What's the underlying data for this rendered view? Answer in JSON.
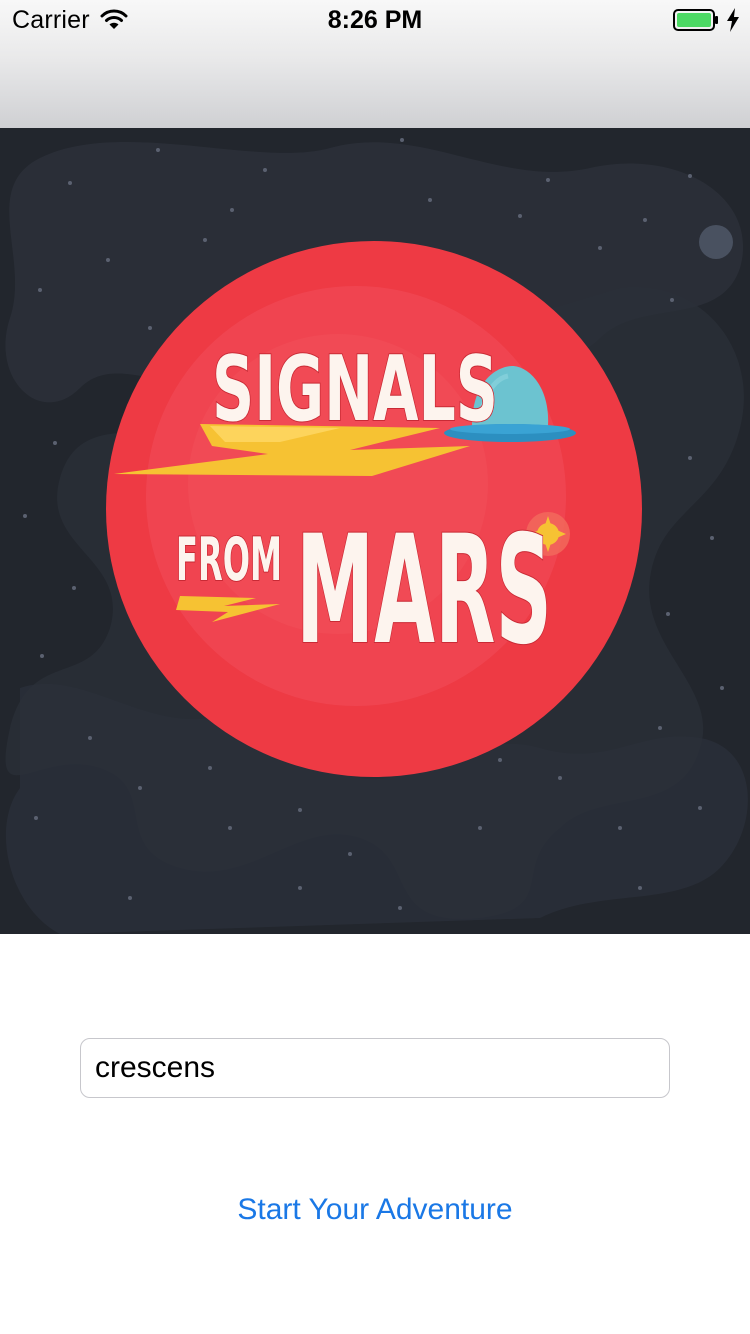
{
  "status_bar": {
    "carrier": "Carrier",
    "time": "8:26 PM",
    "icons": [
      "wifi-icon",
      "battery-icon",
      "charging-bolt-icon"
    ],
    "battery_color": "#4cd964"
  },
  "hero": {
    "logo_words": [
      "SIGNALS",
      "FROM",
      "MARS"
    ],
    "colors": {
      "space": "#22262d",
      "planet": "#ee3a44",
      "bolt": "#f6c233",
      "ufo_dome": "#6cc3d0",
      "ufo_disc": "#2c8fc0"
    }
  },
  "form": {
    "name_value": "crescens",
    "start_label": "Start Your Adventure",
    "accent": "#1a78e6"
  }
}
